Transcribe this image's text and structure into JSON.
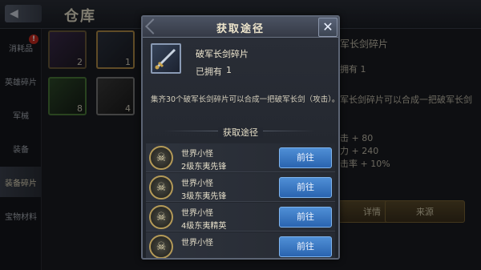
{
  "background": {
    "title": "仓库",
    "side_tabs": [
      {
        "label": "消耗品",
        "badge": "!"
      },
      {
        "label": "英雄碎片"
      },
      {
        "label": "军械"
      },
      {
        "label": "装备"
      },
      {
        "label": "装备碎片"
      },
      {
        "label": "宝物材料"
      }
    ],
    "slots": [
      {
        "count": "2"
      },
      {
        "count": "1"
      },
      {
        "count": "8"
      },
      {
        "count": "4"
      }
    ],
    "right_lines": [
      "军长剑碎片",
      "拥有 1",
      "军长剑碎片可以合成一把破军长剑",
      "击 + 80",
      "力 + 240",
      "击率 + 10%"
    ],
    "detail_label": "详情",
    "equip_label": "来源"
  },
  "modal": {
    "title": "获取途径",
    "close_label": "✕",
    "item_name": "破军长剑碎片",
    "owned_label": "已拥有",
    "owned_count": "1",
    "description": "集齐30个破军长剑碎片可以合成一把破军长剑（攻击）。",
    "section_title": "获取途径",
    "routes": [
      {
        "name": "世界小怪",
        "sub": "2级东夷先锋",
        "button": "前往"
      },
      {
        "name": "世界小怪",
        "sub": "3级东夷先锋",
        "button": "前往"
      },
      {
        "name": "世界小怪",
        "sub": "4级东夷精英",
        "button": "前往"
      },
      {
        "name": "世界小怪",
        "sub": "",
        "button": "前往"
      }
    ]
  },
  "colors": {
    "accent_blue": "#2a64b0",
    "gold_border": "#b49a58"
  },
  "icons": {
    "item": "sword-fragment-icon",
    "route": "monster-skull-icon",
    "close": "close-icon"
  }
}
